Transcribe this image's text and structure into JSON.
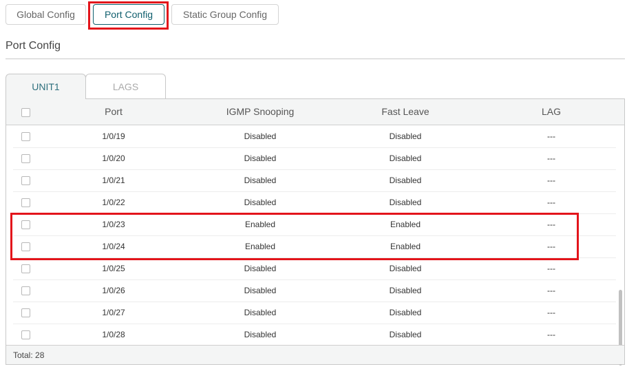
{
  "top_tabs": [
    {
      "label": "Global Config",
      "active": false
    },
    {
      "label": "Port Config",
      "active": true
    },
    {
      "label": "Static Group Config",
      "active": false
    }
  ],
  "section_title": "Port Config",
  "unit_tabs": [
    {
      "label": "UNIT1",
      "active": true
    },
    {
      "label": "LAGS",
      "active": false
    }
  ],
  "table": {
    "headers": {
      "port": "Port",
      "igmp": "IGMP Snooping",
      "fast_leave": "Fast Leave",
      "lag": "LAG"
    },
    "rows": [
      {
        "port": "1/0/19",
        "igmp": "Disabled",
        "fast_leave": "Disabled",
        "lag": "---"
      },
      {
        "port": "1/0/20",
        "igmp": "Disabled",
        "fast_leave": "Disabled",
        "lag": "---"
      },
      {
        "port": "1/0/21",
        "igmp": "Disabled",
        "fast_leave": "Disabled",
        "lag": "---"
      },
      {
        "port": "1/0/22",
        "igmp": "Disabled",
        "fast_leave": "Disabled",
        "lag": "---"
      },
      {
        "port": "1/0/23",
        "igmp": "Enabled",
        "fast_leave": "Enabled",
        "lag": "---"
      },
      {
        "port": "1/0/24",
        "igmp": "Enabled",
        "fast_leave": "Enabled",
        "lag": "---"
      },
      {
        "port": "1/0/25",
        "igmp": "Disabled",
        "fast_leave": "Disabled",
        "lag": "---"
      },
      {
        "port": "1/0/26",
        "igmp": "Disabled",
        "fast_leave": "Disabled",
        "lag": "---"
      },
      {
        "port": "1/0/27",
        "igmp": "Disabled",
        "fast_leave": "Disabled",
        "lag": "---"
      },
      {
        "port": "1/0/28",
        "igmp": "Disabled",
        "fast_leave": "Disabled",
        "lag": "---"
      }
    ],
    "total_label": "Total: 28"
  },
  "colors": {
    "accent": "#0f5e6d",
    "highlight": "#e3141b"
  }
}
